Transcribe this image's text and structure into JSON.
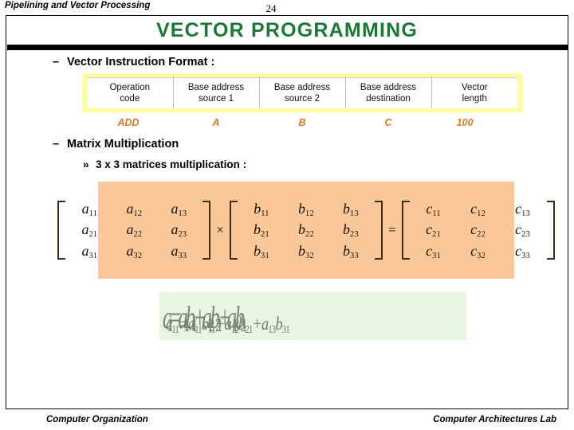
{
  "header": {
    "chapter": "Pipelining and Vector Processing",
    "page_number": "24"
  },
  "title": "VECTOR  PROGRAMMING",
  "bullets": {
    "format_dash": "–",
    "format_label": "Vector Instruction Format :",
    "matmul_dash": "–",
    "matmul_label": "Matrix Multiplication",
    "threebythree_marker": "»",
    "threebythree_label": "3 x 3 matrices multiplication :"
  },
  "instruction_format": {
    "columns": [
      {
        "line1": "Operation",
        "line2": "code"
      },
      {
        "line1": "Base address",
        "line2": "source 1"
      },
      {
        "line1": "Base address",
        "line2": "source 2"
      },
      {
        "line1": "Base address",
        "line2": "destination"
      },
      {
        "line1": "Vector",
        "line2": "length"
      }
    ],
    "operands": [
      "ADD",
      "A",
      "B",
      "C",
      "100"
    ],
    "highlight_color": "#ffff99",
    "operand_color": "#d97b24"
  },
  "matrix_equation": {
    "background_color": "#fac898",
    "multiply_symbol": "×",
    "equals_symbol": "=",
    "matrix_a": [
      [
        "a",
        "11"
      ],
      [
        "a",
        "12"
      ],
      [
        "a",
        "13"
      ],
      [
        "a",
        "21"
      ],
      [
        "a",
        "22"
      ],
      [
        "a",
        "23"
      ],
      [
        "a",
        "31"
      ],
      [
        "a",
        "32"
      ],
      [
        "a",
        "33"
      ]
    ],
    "matrix_b": [
      [
        "b",
        "11"
      ],
      [
        "b",
        "12"
      ],
      [
        "b",
        "13"
      ],
      [
        "b",
        "21"
      ],
      [
        "b",
        "22"
      ],
      [
        "b",
        "23"
      ],
      [
        "b",
        "31"
      ],
      [
        "b",
        "32"
      ],
      [
        "b",
        "33"
      ]
    ],
    "matrix_c": [
      [
        "c",
        "11"
      ],
      [
        "c",
        "12"
      ],
      [
        "c",
        "13"
      ],
      [
        "c",
        "21"
      ],
      [
        "c",
        "22"
      ],
      [
        "c",
        "23"
      ],
      [
        "c",
        "31"
      ],
      [
        "c",
        "32"
      ],
      [
        "c",
        "33"
      ]
    ]
  },
  "formula": {
    "background_color": "#e8f5e0",
    "text_color": "#717f6a",
    "parts": [
      "c",
      "11",
      "=",
      "a",
      "11",
      "b",
      "11",
      "+",
      "a",
      "12",
      "b",
      "21",
      "+",
      "a",
      "13",
      "b",
      "31"
    ],
    "plain": "c11 = a11b11 + a12b21 + a13b31"
  },
  "footer": {
    "left": "Computer Organization",
    "right": "Computer Architectures Lab"
  }
}
